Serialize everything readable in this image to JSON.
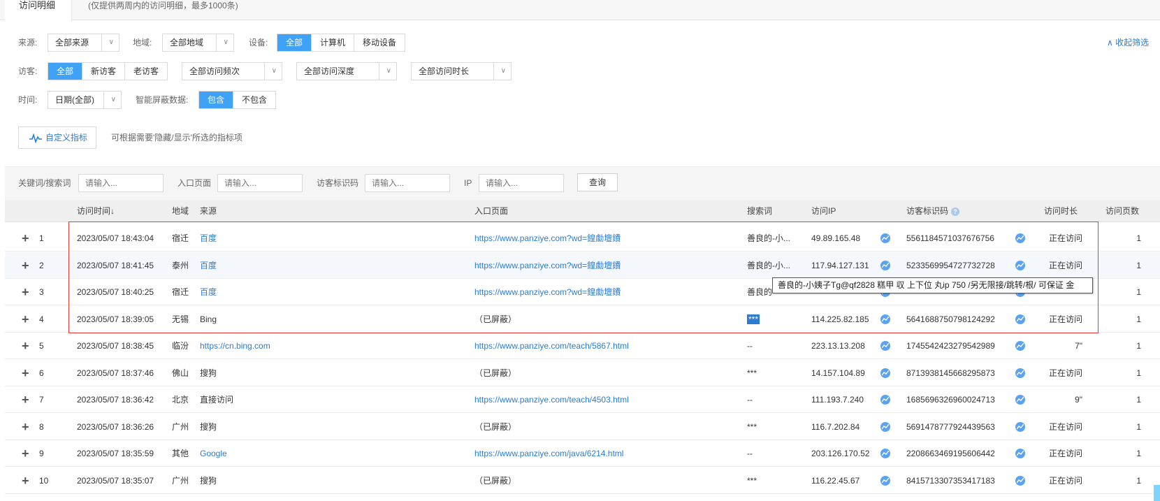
{
  "tab": {
    "active": "访问明细",
    "note": "(仅提供两周内的访问明细，最多1000条)"
  },
  "filters": {
    "source_label": "来源:",
    "source_value": "全部来源",
    "region_label": "地域:",
    "region_value": "全部地域",
    "device_label": "设备:",
    "device_options": [
      "全部",
      "计算机",
      "移动设备"
    ],
    "device_selected": "全部",
    "visitor_label": "访客:",
    "visitor_options": [
      "全部",
      "新访客",
      "老访客"
    ],
    "visitor_selected": "全部",
    "freq_value": "全部访问频次",
    "depth_value": "全部访问深度",
    "duration_value": "全部访问时长",
    "time_label": "时间:",
    "time_value": "日期(全部)",
    "shield_label": "智能屏蔽数据:",
    "shield_options": [
      "包含",
      "不包含"
    ],
    "shield_selected": "包含",
    "collapse_label": "收起筛选"
  },
  "custom": {
    "button_label": "自定义指标",
    "note": "可根据需要'隐藏/显示'所选的指标项"
  },
  "search": {
    "keyword_label": "关键词/搜索词",
    "entry_label": "入口页面",
    "visitor_id_label": "访客标识码",
    "ip_label": "IP",
    "placeholder": "请输入...",
    "query_button": "查询"
  },
  "table": {
    "headers": {
      "time": "访问时间",
      "sort_icon": "down-arrow",
      "region": "地域",
      "source": "来源",
      "entry": "入口页面",
      "keyword": "搜索词",
      "ip": "访问IP",
      "visitor_id": "访客标识码",
      "duration": "访问时长",
      "pages": "访问页数"
    },
    "rows": [
      {
        "no": "1",
        "time": "2023/05/07 18:43:04",
        "region": "宿迁",
        "source": "百度",
        "source_link": true,
        "entry": "https://www.panziye.com?wd=鍠勮壇鐨",
        "entry_link": true,
        "keyword": "善良的-小...",
        "ip": "49.89.165.48",
        "vid": "5561184571037676756",
        "duration": "正在访问",
        "pages": "1"
      },
      {
        "no": "2",
        "time": "2023/05/07 18:41:45",
        "region": "泰州",
        "source": "百度",
        "source_link": true,
        "entry": "https://www.panziye.com?wd=鍠勮壇鐨",
        "entry_link": true,
        "keyword": "善良的-小...",
        "ip": "117.94.127.131",
        "vid": "5233569954727732728",
        "duration": "正在访问",
        "pages": "1"
      },
      {
        "no": "3",
        "time": "2023/05/07 18:40:25",
        "region": "宿迁",
        "source": "百度",
        "source_link": true,
        "entry": "https://www.panziye.com?wd=鍠勮壇鐨",
        "entry_link": true,
        "keyword": "善良的",
        "ip": "",
        "vid": "",
        "duration": "",
        "pages": "1"
      },
      {
        "no": "4",
        "time": "2023/05/07 18:39:05",
        "region": "无锡",
        "source": "Bing",
        "source_link": false,
        "entry": "（已屏蔽）",
        "entry_link": false,
        "keyword": "***",
        "ip": "114.225.82.185",
        "vid": "5641688750798124292",
        "duration": "正在访问",
        "pages": "1"
      },
      {
        "no": "5",
        "time": "2023/05/07 18:38:45",
        "region": "临汾",
        "source": "https://cn.bing.com",
        "source_link": true,
        "entry": "https://www.panziye.com/teach/5867.html",
        "entry_link": true,
        "keyword": "--",
        "ip": "223.13.13.208",
        "vid": "1745542423279542989",
        "duration": "7\"",
        "pages": "1"
      },
      {
        "no": "6",
        "time": "2023/05/07 18:37:46",
        "region": "佛山",
        "source": "搜狗",
        "source_link": false,
        "entry": "（已屏蔽）",
        "entry_link": false,
        "keyword": "***",
        "ip": "14.157.104.89",
        "vid": "8713938145668295873",
        "duration": "正在访问",
        "pages": "1"
      },
      {
        "no": "7",
        "time": "2023/05/07 18:36:42",
        "region": "北京",
        "source": "直接访问",
        "source_link": false,
        "entry": "https://www.panziye.com/teach/4503.html",
        "entry_link": true,
        "keyword": "--",
        "ip": "111.193.7.240",
        "vid": "1685696326960024713",
        "duration": "9\"",
        "pages": "1"
      },
      {
        "no": "8",
        "time": "2023/05/07 18:36:26",
        "region": "广州",
        "source": "搜狗",
        "source_link": false,
        "entry": "（已屏蔽）",
        "entry_link": false,
        "keyword": "***",
        "ip": "116.7.202.84",
        "vid": "5691478777924439563",
        "duration": "正在访问",
        "pages": "1"
      },
      {
        "no": "9",
        "time": "2023/05/07 18:35:59",
        "region": "其他",
        "source": "Google",
        "source_link": true,
        "entry": "https://www.panziye.com/java/6214.html",
        "entry_link": true,
        "keyword": "--",
        "ip": "203.126.170.52",
        "vid": "2208663469195606442",
        "duration": "正在访问",
        "pages": "1"
      },
      {
        "no": "10",
        "time": "2023/05/07 18:35:07",
        "region": "广州",
        "source": "搜狗",
        "source_link": false,
        "entry": "（已屏蔽）",
        "entry_link": false,
        "keyword": "***",
        "ip": "116.22.45.67",
        "vid": "8415713307353417183",
        "duration": "正在访问",
        "pages": "1"
      }
    ]
  },
  "tooltip": "善良的-小姨子Tg@qf2828 糕甲 収 上下位 丸ip 750 /另无限接/跳转/根/ 可保证 金",
  "colors": {
    "accent": "#3fa2f7",
    "link": "#2b7cd3",
    "highlight_box": "#e23b3b"
  }
}
